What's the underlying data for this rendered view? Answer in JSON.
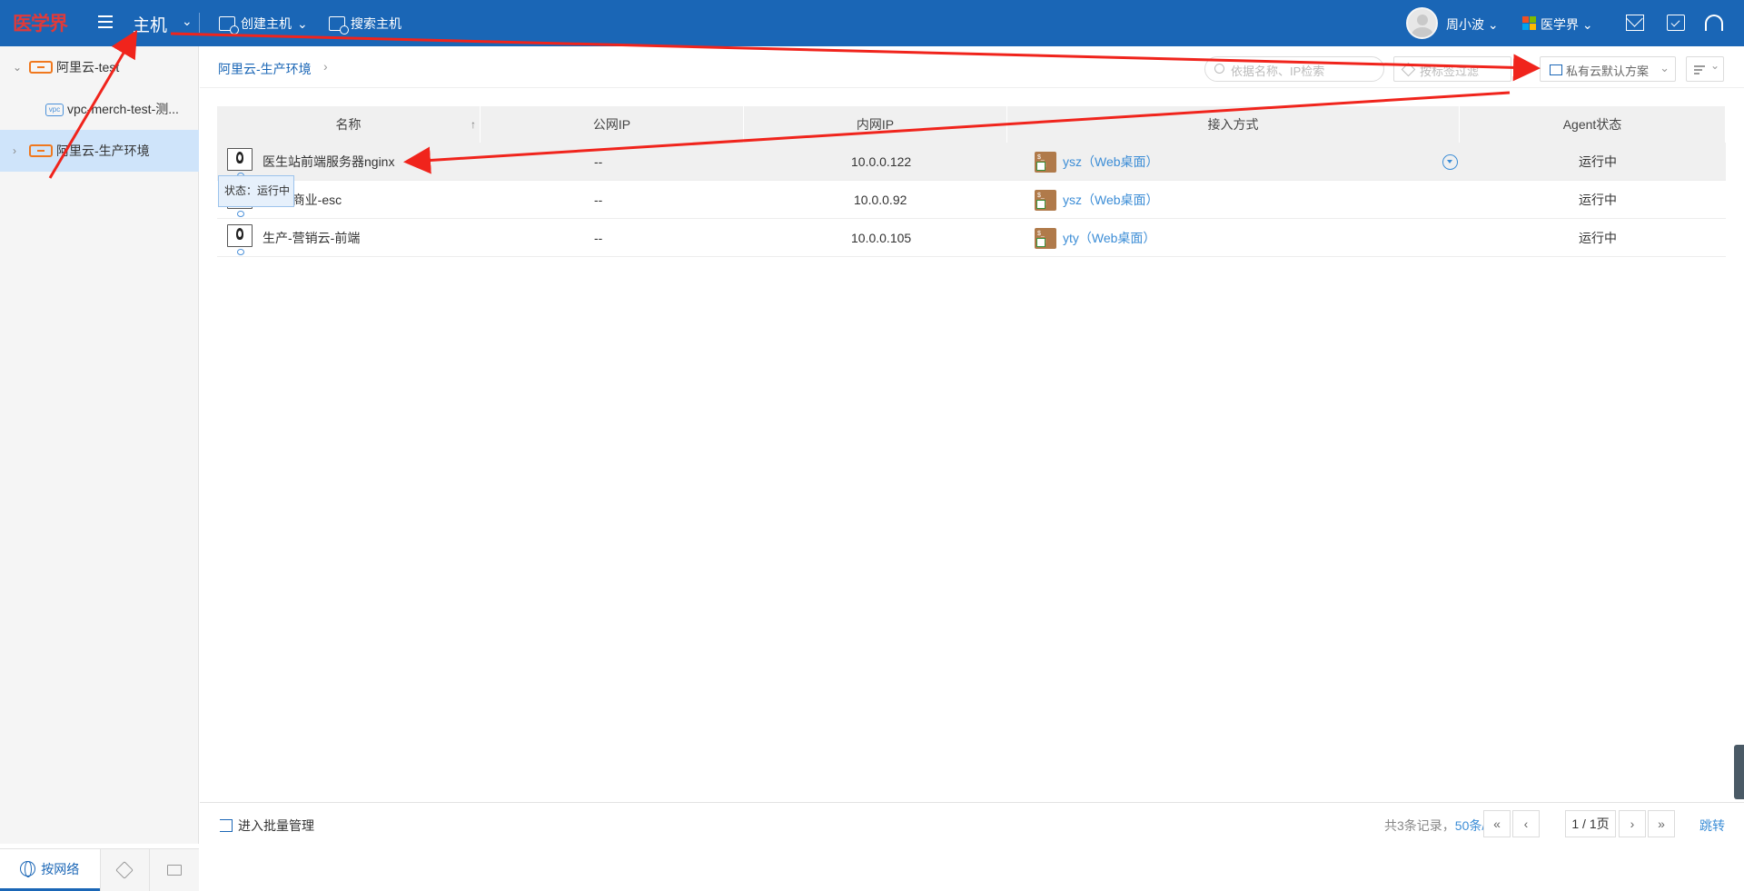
{
  "header": {
    "logo_text": "医学界",
    "module_title": "主机",
    "create_host": "创建主机",
    "search_host": "搜索主机",
    "user_name": "周小波",
    "org_name": "医学界",
    "colors": {
      "bar": "#1a66b6",
      "logo": "#e03a3a"
    }
  },
  "sidebar": {
    "tree": [
      {
        "label": "阿里云-test",
        "icon": "aliyun-icon"
      },
      {
        "label": "vpc-merch-test-测...",
        "icon": "vpc-icon"
      },
      {
        "label": "阿里云-生产环境",
        "icon": "aliyun-icon",
        "selected": true
      }
    ],
    "tabs": {
      "network": "按网络"
    }
  },
  "toolbar": {
    "breadcrumb": "阿里云-生产环境",
    "search_placeholder": "依据名称、IP检索",
    "tag_filter": "按标签过滤",
    "scheme": "私有云默认方案"
  },
  "table": {
    "columns": [
      "名称",
      "公网IP",
      "内网IP",
      "接入方式",
      "Agent状态"
    ],
    "rows": [
      {
        "name": "医生站前端服务器nginx",
        "public_ip": "--",
        "private_ip": "10.0.0.122",
        "access_user": "ysz",
        "access_type": "（Web桌面）",
        "agent": "运行中"
      },
      {
        "name": "前端-商业-esc",
        "public_ip": "--",
        "private_ip": "10.0.0.92",
        "access_user": "ysz",
        "access_type": "（Web桌面）",
        "agent": "运行中"
      },
      {
        "name": "生产-营销云-前端",
        "public_ip": "--",
        "private_ip": "10.0.0.105",
        "access_user": "yty",
        "access_type": "（Web桌面）",
        "agent": "运行中"
      }
    ],
    "tooltip": "状态：运行中"
  },
  "footer": {
    "batch": "进入批量管理",
    "total": "共3条记录，",
    "page_size": "50条/页",
    "page": "1 / 1页",
    "jump": "跳转",
    "first": "«",
    "prev": "‹",
    "next": "›",
    "last": "»"
  }
}
